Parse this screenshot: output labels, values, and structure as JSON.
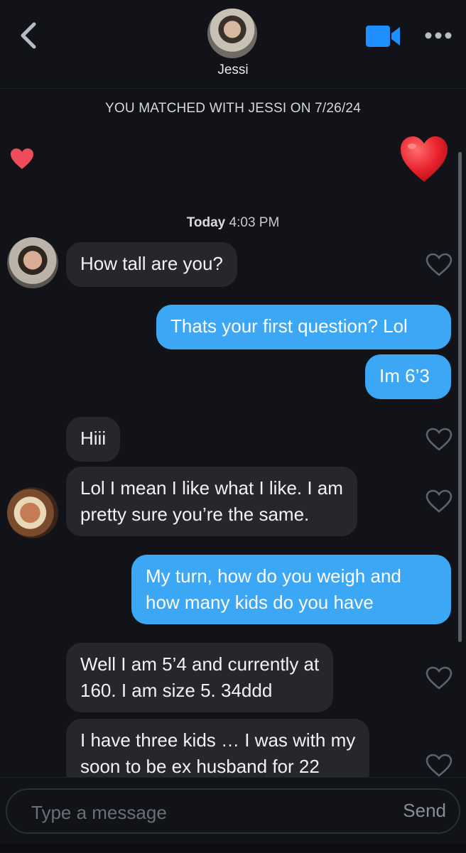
{
  "header": {
    "contact_name": "Jessi",
    "accent_color": "#1e90ff"
  },
  "match_banner": "YOU MATCHED WITH JESSI ON 7/26/24",
  "timestamp": {
    "day": "Today",
    "time": "4:03 PM"
  },
  "messages": [
    {
      "from": "them",
      "text": "How tall are you?"
    },
    {
      "from": "me",
      "text": "Thats your first question? Lol"
    },
    {
      "from": "me",
      "text": "Im 6’3"
    },
    {
      "from": "them",
      "text": "Hiii"
    },
    {
      "from": "them",
      "lines": [
        "Lol I mean I like what I like. I am",
        "pretty sure you’re the same."
      ]
    },
    {
      "from": "me",
      "lines": [
        "My turn, how do you weigh and",
        "how many kids do you have"
      ]
    },
    {
      "from": "them",
      "lines": [
        "Well I am 5’4 and currently at",
        "160. I am size 5. 34ddd"
      ]
    },
    {
      "from": "them",
      "lines": [
        "I have three kids … I was with my",
        "soon to be ex husband for 22"
      ]
    }
  ],
  "composer": {
    "placeholder": "Type a message",
    "send_label": "Send"
  },
  "colors": {
    "background": "#111318",
    "incoming_bubble": "#25272d",
    "outgoing_bubble": "#3ba7f5",
    "heart_red": "#e8323c"
  }
}
